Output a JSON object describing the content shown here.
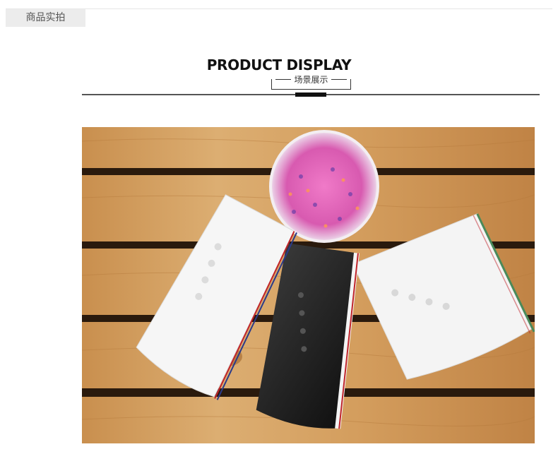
{
  "header": {
    "tag_label": "商品实拍"
  },
  "section": {
    "title": "PRODUCT DISPLAY",
    "subtitle": "场景展示"
  },
  "photo": {
    "icon": "product-photo",
    "colors": {
      "wood_light": "#d9a867",
      "wood_dark": "#a26a32",
      "gap": "#2a1a0d",
      "shoe_black": "#1c1c1c",
      "shoe_white": "#f4f4f4",
      "stripe_red": "#c0242a",
      "stripe_blue": "#2a3a8a",
      "stripe_green": "#4a8a5a",
      "beads": "#e060b0"
    }
  }
}
